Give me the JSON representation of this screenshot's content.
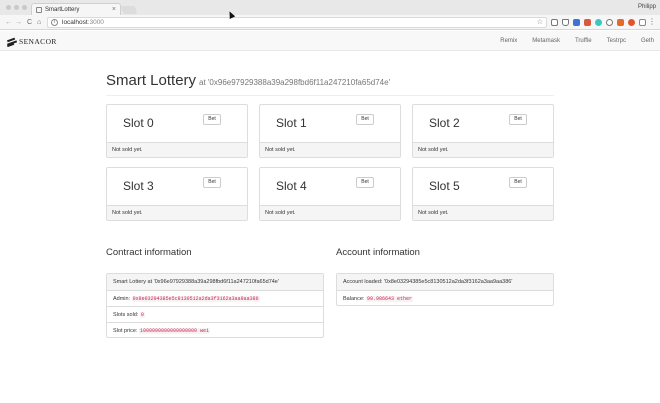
{
  "browser": {
    "tab_title": "SmartLottery",
    "tab_close": "×",
    "profile": "Philipp",
    "url_host": "localhost",
    "url_port": ":3000",
    "back": "←",
    "forward": "→",
    "reload": "C",
    "home": "⌂",
    "star": "☆",
    "menu": "⋮"
  },
  "nav": {
    "brand": "SENACOR",
    "links": [
      "Remix",
      "Metamask",
      "Truffle",
      "Testrpc",
      "Geth"
    ]
  },
  "header": {
    "title": "Smart Lottery",
    "subtitle": "at '0x96e97929388a39a298fbd6f11a247210fa65d74e'"
  },
  "slots": [
    {
      "name": "Slot 0",
      "button": "Bet",
      "status": "Not sold yet."
    },
    {
      "name": "Slot 1",
      "button": "Bet",
      "status": "Not sold yet."
    },
    {
      "name": "Slot 2",
      "button": "Bet",
      "status": "Not sold yet."
    },
    {
      "name": "Slot 3",
      "button": "Bet",
      "status": "Not sold yet."
    },
    {
      "name": "Slot 4",
      "button": "Bet",
      "status": "Not sold yet."
    },
    {
      "name": "Slot 5",
      "button": "Bet",
      "status": "Not sold yet."
    }
  ],
  "contract": {
    "title": "Contract information",
    "heading": "Smart Lottery at '0x96e97929388a39a298fbd6f11a247210fa65d74e'",
    "admin_label": "Admin:",
    "admin_value": "0x8e03294385e5c8130512a2da3f3162a3aa9aa386",
    "sold_label": "Slots sold:",
    "sold_value": "0",
    "price_label": "Slot price:",
    "price_value": "1000000000000000000 wei"
  },
  "account": {
    "title": "Account information",
    "loaded": "Account loaded: '0x8e03294385e5c8130512a2da3f3162a3aa9aa386'",
    "balance_label": "Balance:",
    "balance_value": "99.986643 ether"
  },
  "colors": {
    "code_text": "#c7254e",
    "code_bg": "#f9f2f4",
    "panel_head": "#f5f5f5",
    "border": "#dddddd"
  }
}
